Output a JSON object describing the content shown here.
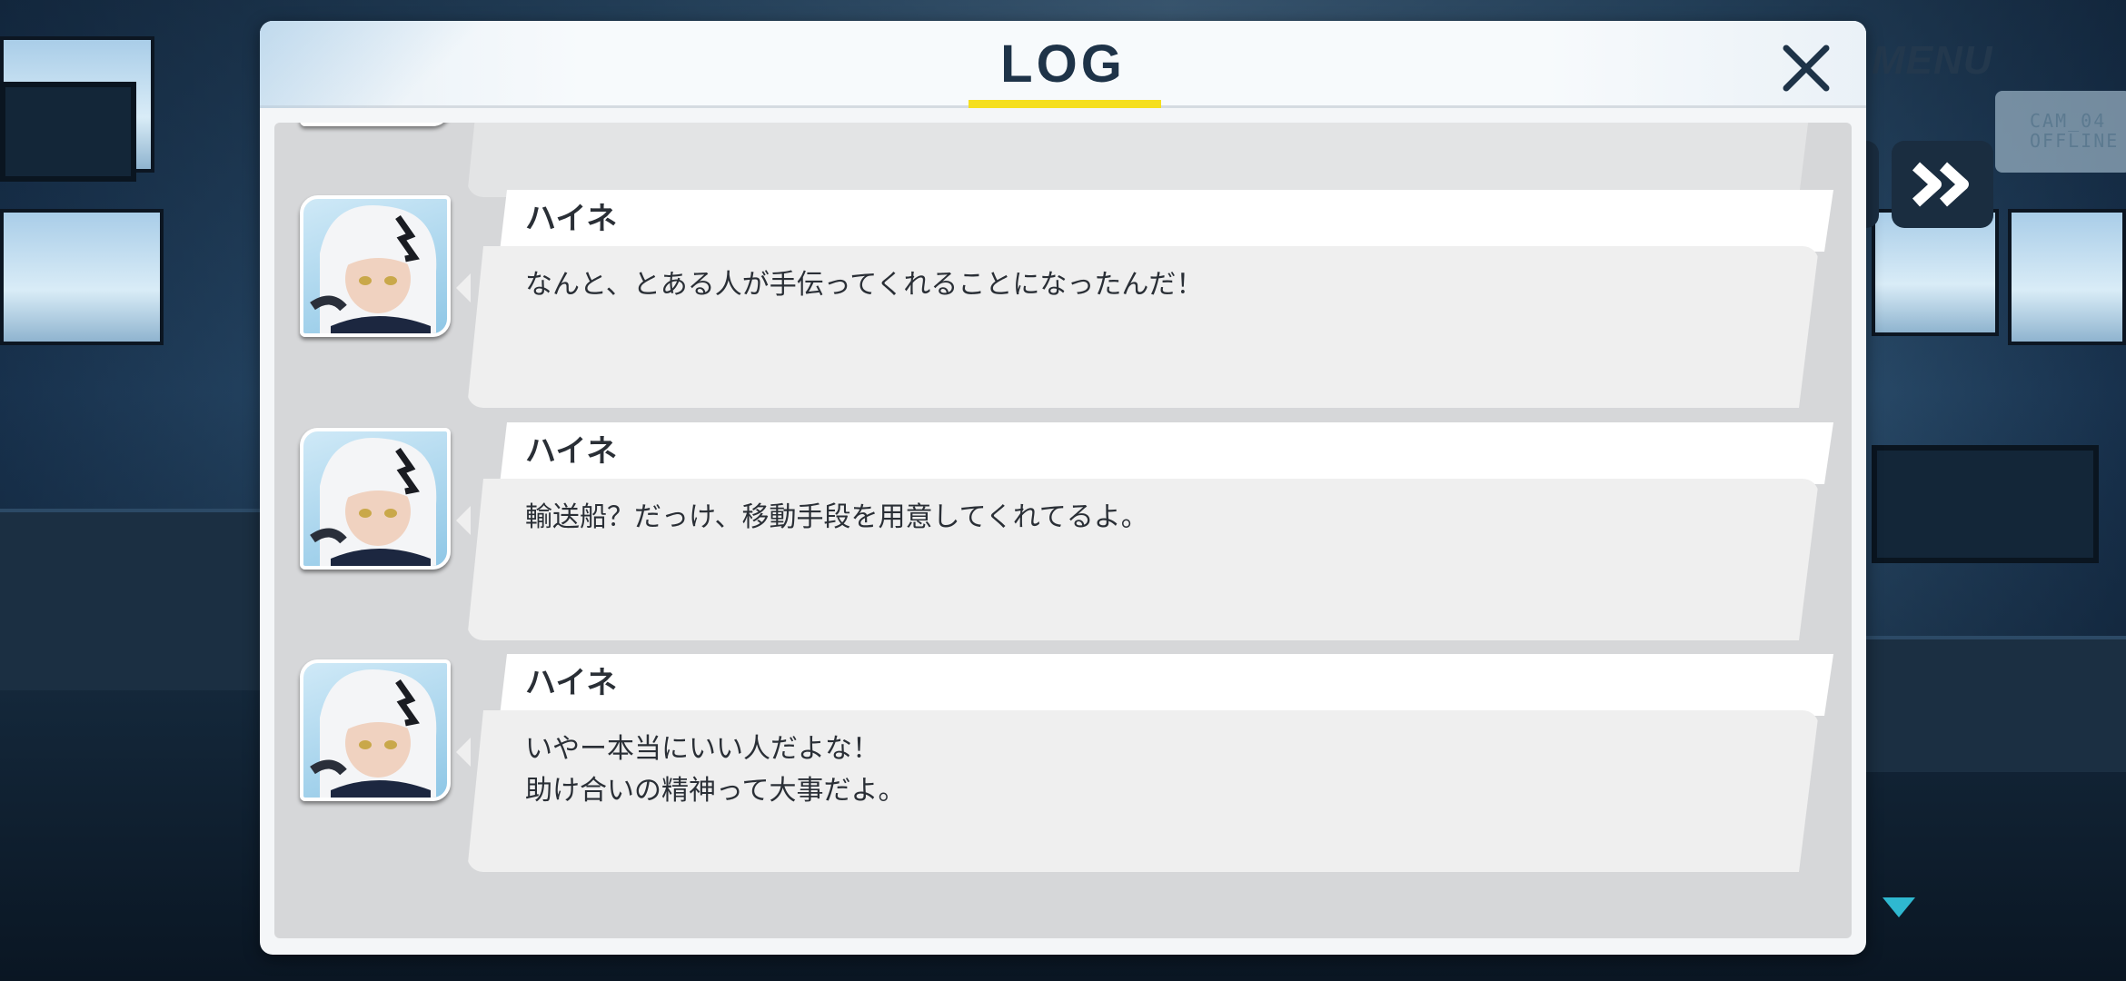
{
  "hud": {
    "menu_label": "MENU",
    "cam_sign_line1": "CAM_04",
    "cam_sign_line2": "OFFLINE"
  },
  "log": {
    "title": "LOG",
    "entries": [
      {
        "speaker": "",
        "text": "",
        "avatar": "heine-portrait"
      },
      {
        "speaker": "ハイネ",
        "text": "なんと、とある人が手伝ってくれることになったんだ！",
        "avatar": "heine-portrait"
      },
      {
        "speaker": "ハイネ",
        "text": "輸送船？だっけ、移動手段を用意してくれてるよ。",
        "avatar": "heine-portrait"
      },
      {
        "speaker": "ハイネ",
        "text": "いやー本当にいい人だよな！\n助け合いの精神って大事だよ。",
        "avatar": "heine-portrait"
      }
    ]
  },
  "colors": {
    "accent_underline": "#f5df1e",
    "title_text": "#1e3348",
    "next_indicator": "#2fb8d0"
  },
  "icons": {
    "close": "close-icon",
    "fast_forward": "fast-forward-icon",
    "next": "next-triangle-icon"
  }
}
